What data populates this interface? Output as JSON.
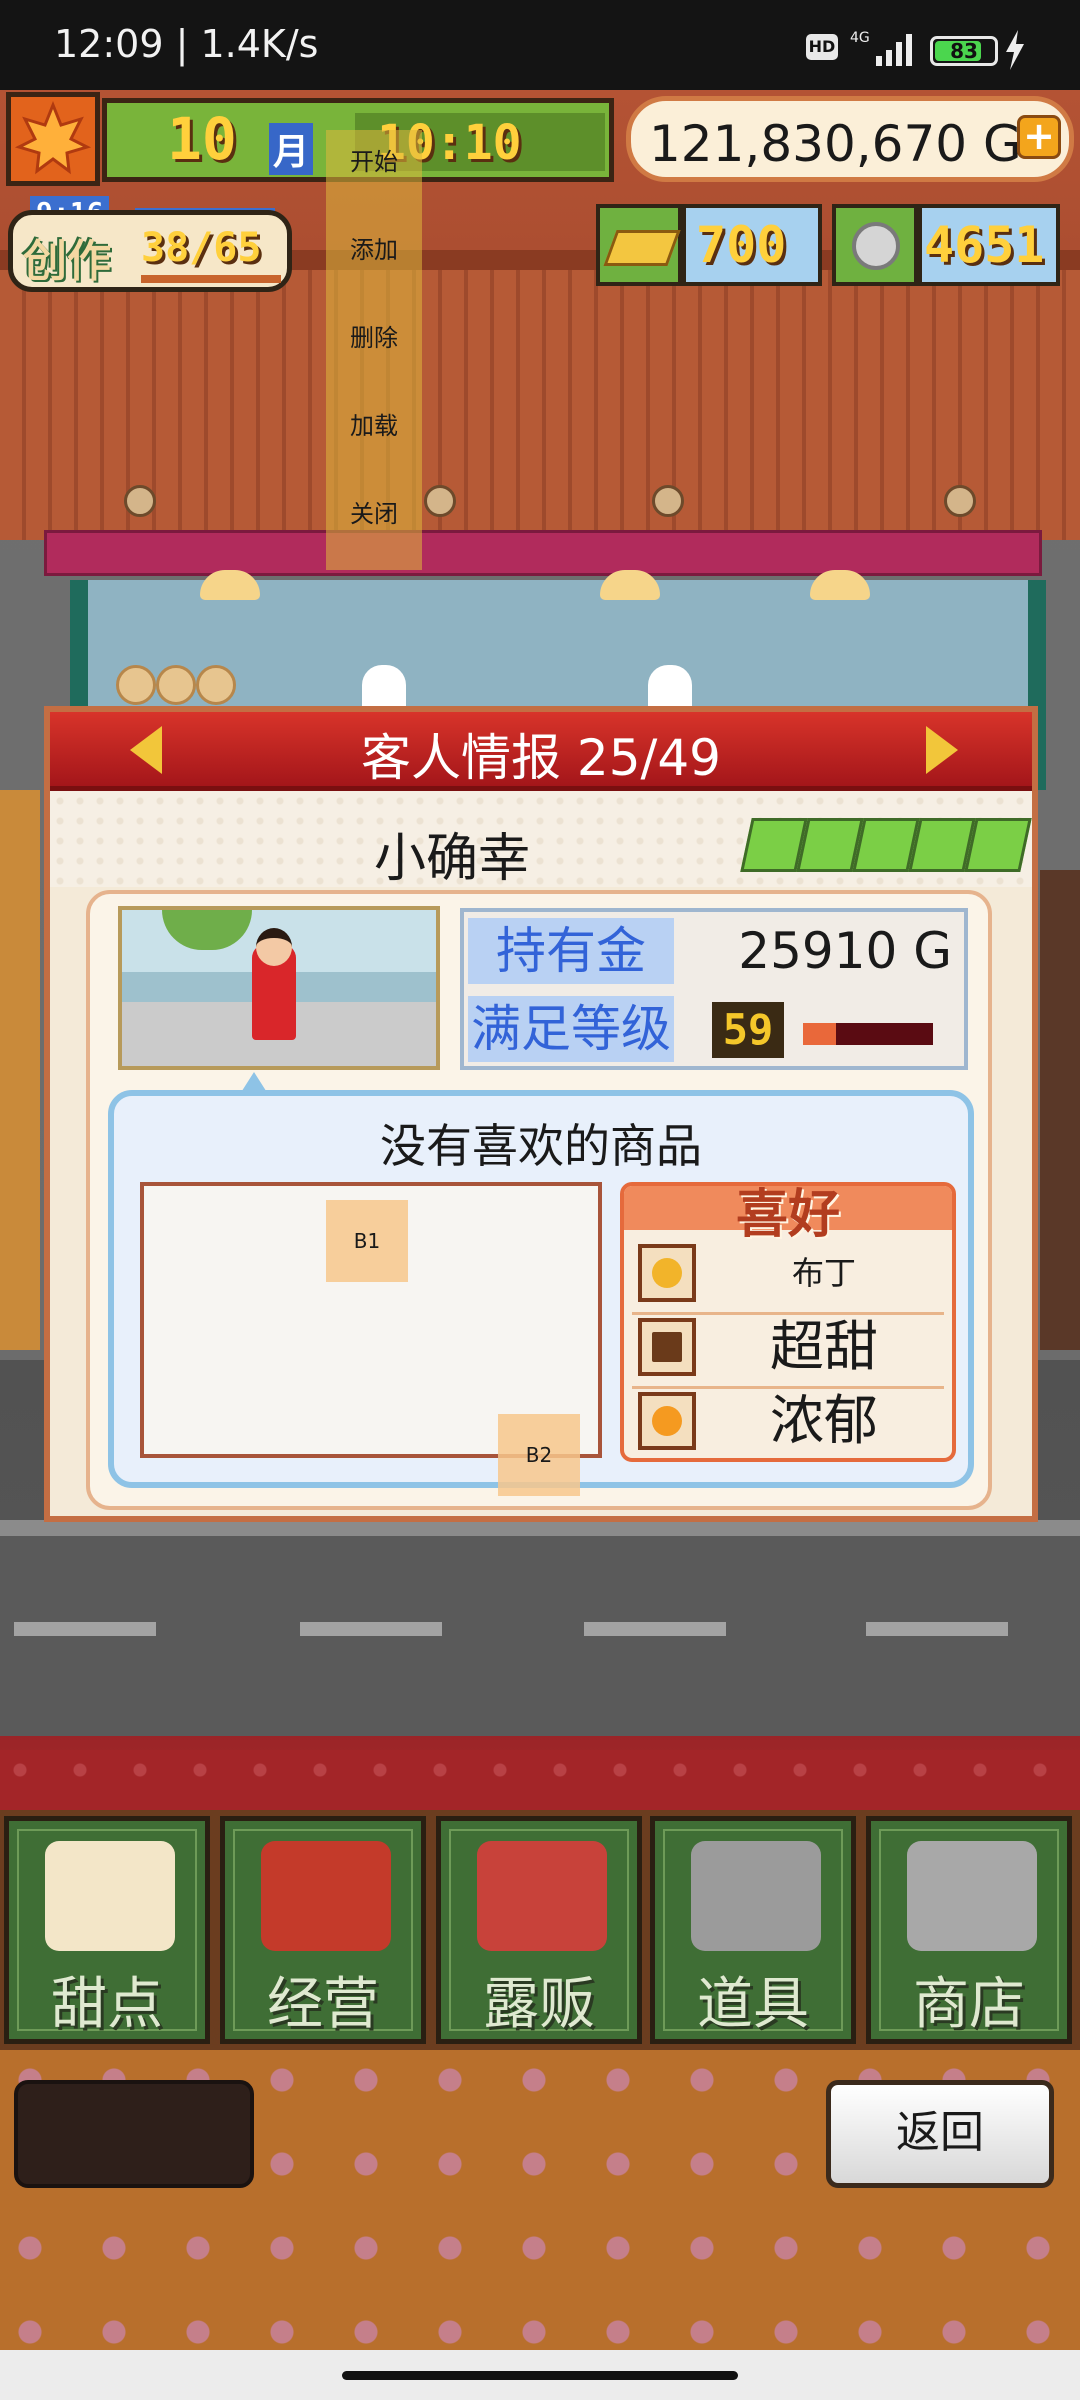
{
  "status_bar": {
    "time_speed": "12:09 | 1.4K/s",
    "hd": "HD",
    "network": "4G",
    "battery": "83"
  },
  "hud": {
    "month_number": "10",
    "month_unit": "月",
    "clock": "10:10",
    "money": "121,830,670 G",
    "add": "+",
    "create_label": "创作",
    "create_count": "38/65",
    "create_time": "9:16",
    "gold_count": "700",
    "silver_count": "4651"
  },
  "menu": {
    "items": [
      "开始",
      "添加",
      "删除",
      "加载",
      "关闭"
    ]
  },
  "panel": {
    "title": "客人情报 25/49",
    "customer_name": "小确幸",
    "money_label": "持有金",
    "money_value": "25910 G",
    "satisfaction_label": "满足等级",
    "satisfaction_level": "59",
    "satisfaction_fill": 0.25,
    "rank_stars": 5,
    "bubble_title": "没有喜欢的商品",
    "preferences_title": "喜好",
    "preferences": [
      {
        "label": "布丁",
        "icon": "pudding-icon"
      },
      {
        "label": "超甜",
        "icon": "chocolate-icon"
      },
      {
        "label": "浓郁",
        "icon": "orange-drop-icon"
      }
    ]
  },
  "markers": {
    "b1": "B1",
    "b2": "B2"
  },
  "nav": {
    "items": [
      {
        "label": "甜点",
        "icon": "cake-icon"
      },
      {
        "label": "经营",
        "icon": "shop-icon"
      },
      {
        "label": "露贩",
        "icon": "food-truck-icon"
      },
      {
        "label": "道具",
        "icon": "items-bag-icon"
      },
      {
        "label": "商店",
        "icon": "shopping-cart-icon"
      }
    ]
  },
  "back_label": "返回",
  "colors": {
    "panel_header": "#c8201e",
    "accent_gold": "#ffd03c",
    "nav_green": "#3f6e35"
  }
}
